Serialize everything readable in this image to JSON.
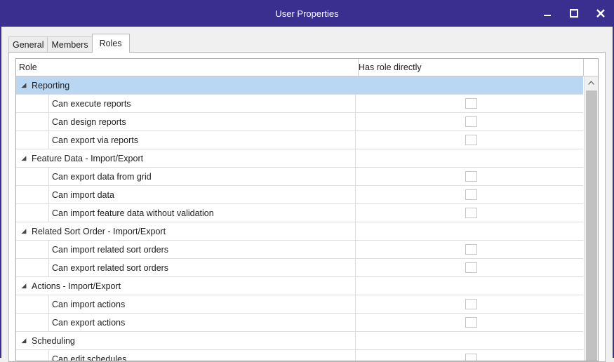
{
  "window": {
    "title": "User Properties"
  },
  "tabs": [
    "General",
    "Members",
    "Roles"
  ],
  "active_tab": "Roles",
  "grid": {
    "columns": [
      "Role",
      "Has role directly"
    ],
    "rows": [
      {
        "type": "group",
        "label": "Reporting",
        "selected": true
      },
      {
        "type": "child",
        "label": "Can execute reports",
        "checked": false
      },
      {
        "type": "child",
        "label": "Can design reports",
        "checked": false
      },
      {
        "type": "child",
        "label": "Can export via reports",
        "checked": false
      },
      {
        "type": "group",
        "label": "Feature Data - Import/Export"
      },
      {
        "type": "child",
        "label": "Can export data from grid",
        "checked": false
      },
      {
        "type": "child",
        "label": "Can import data",
        "checked": false
      },
      {
        "type": "child",
        "label": "Can import feature data without validation",
        "checked": false
      },
      {
        "type": "group",
        "label": "Related Sort Order - Import/Export"
      },
      {
        "type": "child",
        "label": "Can import related sort orders",
        "checked": false
      },
      {
        "type": "child",
        "label": "Can export related sort orders",
        "checked": false
      },
      {
        "type": "group",
        "label": "Actions - Import/Export"
      },
      {
        "type": "child",
        "label": "Can import actions",
        "checked": false
      },
      {
        "type": "child",
        "label": "Can export actions",
        "checked": false
      },
      {
        "type": "group",
        "label": "Scheduling"
      },
      {
        "type": "child",
        "label": "Can edit schedules",
        "checked": false
      }
    ]
  },
  "colors": {
    "titlebar": "#3a2f8f",
    "selection": "#b9d6f2"
  }
}
